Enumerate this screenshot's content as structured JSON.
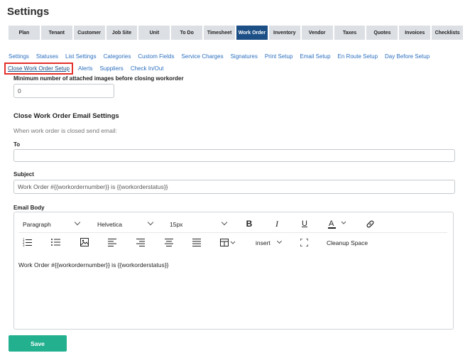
{
  "page": {
    "title": "Settings"
  },
  "main_tabs": [
    {
      "label": "Plan",
      "active": false
    },
    {
      "label": "Tenant",
      "active": false
    },
    {
      "label": "Customer",
      "active": false
    },
    {
      "label": "Job Site",
      "active": false
    },
    {
      "label": "Unit",
      "active": false
    },
    {
      "label": "To Do",
      "active": false
    },
    {
      "label": "Timesheet",
      "active": false
    },
    {
      "label": "Work Order",
      "active": true
    },
    {
      "label": "Inventory",
      "active": false
    },
    {
      "label": "Vendor",
      "active": false
    },
    {
      "label": "Taxes",
      "active": false
    },
    {
      "label": "Quotes",
      "active": false
    },
    {
      "label": "Invoices",
      "active": false
    },
    {
      "label": "Checklists",
      "active": false
    }
  ],
  "sub_nav_row1": [
    "Settings",
    "Statuses",
    "List Settings",
    "Categories",
    "Custom Fields",
    "Service Charges",
    "Signatures",
    "Print Setup",
    "Email Setup",
    "En Route Setup",
    "Day Before Setup"
  ],
  "sub_nav_row2": [
    {
      "label": "Close Work Order Setup",
      "active": true
    },
    {
      "label": "Alerts",
      "active": false
    },
    {
      "label": "Suppliers",
      "active": false
    },
    {
      "label": "Check In/Out",
      "active": false
    }
  ],
  "form": {
    "min_images_label": "Minimum number of attached images before closing workorder",
    "min_images_value": "0",
    "email_section_title": "Close Work Order Email Settings",
    "email_note": "When work order is closed send email:",
    "to_label": "To",
    "to_value": "",
    "subject_label": "Subject",
    "subject_value": "Work Order #{{workordernumber}} is {{workorderstatus}}",
    "body_label": "Email Body"
  },
  "editor": {
    "format_value": "Paragraph",
    "font_value": "Helvetica",
    "size_value": "15px",
    "insert_label": "insert",
    "cleanup_label": "Cleanup Space",
    "content": "Work Order #{{workordernumber}} is {{workorderstatus}}"
  },
  "actions": {
    "save_label": "Save"
  },
  "colors": {
    "active_tab": "#1c4f86",
    "link": "#2c6fbf",
    "highlight": "#e3302a",
    "save": "#22b08f"
  }
}
